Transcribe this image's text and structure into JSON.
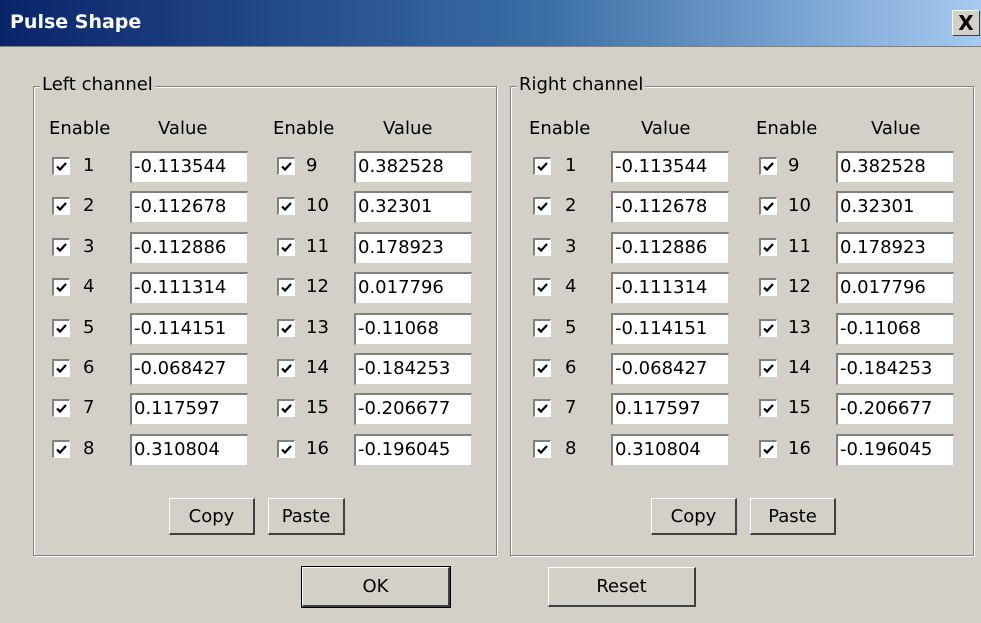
{
  "window": {
    "title": "Pulse Shape",
    "close_glyph": "X"
  },
  "headers": {
    "enable": "Enable",
    "value": "Value"
  },
  "left": {
    "label": "Left channel",
    "copy_label": "Copy",
    "paste_label": "Paste",
    "rows": [
      {
        "n": "1",
        "v": "-0.113544"
      },
      {
        "n": "2",
        "v": "-0.112678"
      },
      {
        "n": "3",
        "v": "-0.112886"
      },
      {
        "n": "4",
        "v": "-0.111314"
      },
      {
        "n": "5",
        "v": "-0.114151"
      },
      {
        "n": "6",
        "v": "-0.068427"
      },
      {
        "n": "7",
        "v": "0.117597"
      },
      {
        "n": "8",
        "v": "0.310804"
      },
      {
        "n": "9",
        "v": "0.382528"
      },
      {
        "n": "10",
        "v": "0.32301"
      },
      {
        "n": "11",
        "v": "0.178923"
      },
      {
        "n": "12",
        "v": "0.017796"
      },
      {
        "n": "13",
        "v": "-0.11068"
      },
      {
        "n": "14",
        "v": "-0.184253"
      },
      {
        "n": "15",
        "v": "-0.206677"
      },
      {
        "n": "16",
        "v": "-0.196045"
      }
    ]
  },
  "right": {
    "label": "Right channel",
    "copy_label": "Copy",
    "paste_label": "Paste",
    "rows": [
      {
        "n": "1",
        "v": "-0.113544"
      },
      {
        "n": "2",
        "v": "-0.112678"
      },
      {
        "n": "3",
        "v": "-0.112886"
      },
      {
        "n": "4",
        "v": "-0.111314"
      },
      {
        "n": "5",
        "v": "-0.114151"
      },
      {
        "n": "6",
        "v": "-0.068427"
      },
      {
        "n": "7",
        "v": "0.117597"
      },
      {
        "n": "8",
        "v": "0.310804"
      },
      {
        "n": "9",
        "v": "0.382528"
      },
      {
        "n": "10",
        "v": "0.32301"
      },
      {
        "n": "11",
        "v": "0.178923"
      },
      {
        "n": "12",
        "v": "0.017796"
      },
      {
        "n": "13",
        "v": "-0.11068"
      },
      {
        "n": "14",
        "v": "-0.184253"
      },
      {
        "n": "15",
        "v": "-0.206677"
      },
      {
        "n": "16",
        "v": "-0.196045"
      }
    ]
  },
  "buttons": {
    "ok": "OK",
    "reset": "Reset"
  }
}
